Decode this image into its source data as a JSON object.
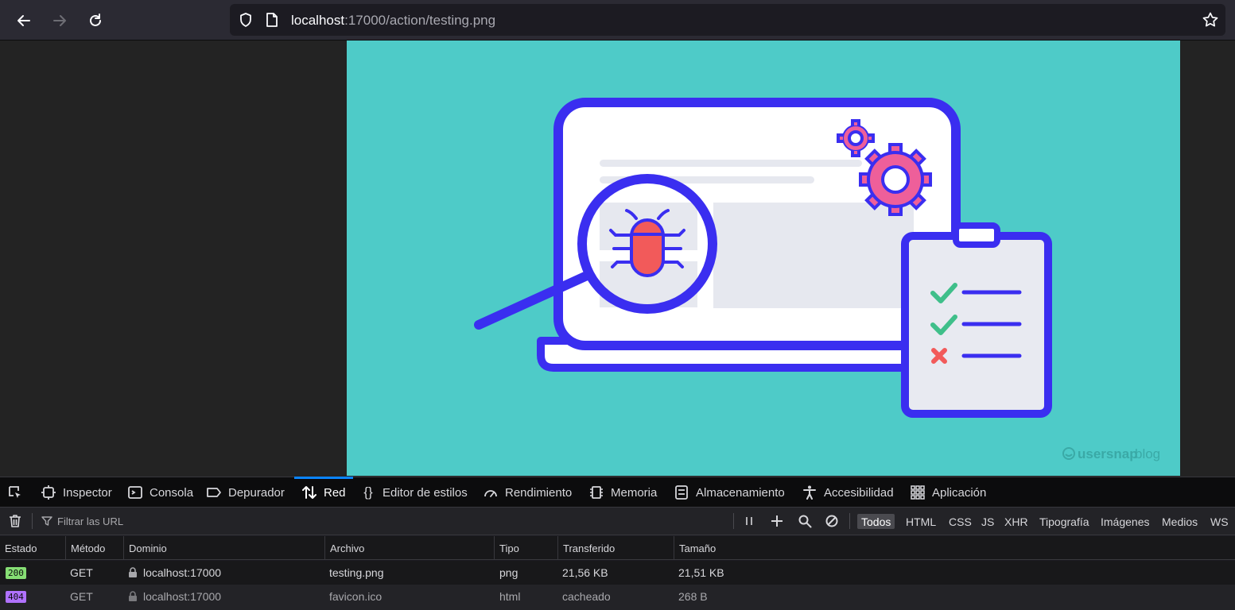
{
  "browser": {
    "url_host": "localhost",
    "url_rest": ":17000/action/testing.png"
  },
  "image": {
    "watermark_brand": "usersnap",
    "watermark_suffix": "blog",
    "colors": {
      "background": "#4ecbc8",
      "outline": "#3a2ef0",
      "bug": "#f25a5a",
      "gear": "#ee5f9a",
      "check": "#3fbf8a"
    }
  },
  "devtools": {
    "tabs": [
      {
        "label": "Inspector",
        "icon": "inspector-icon"
      },
      {
        "label": "Consola",
        "icon": "console-icon"
      },
      {
        "label": "Depurador",
        "icon": "debugger-icon"
      },
      {
        "label": "Red",
        "icon": "network-icon",
        "active": true
      },
      {
        "label": "Editor de estilos",
        "icon": "style-editor-icon"
      },
      {
        "label": "Rendimiento",
        "icon": "performance-icon"
      },
      {
        "label": "Memoria",
        "icon": "memory-icon"
      },
      {
        "label": "Almacenamiento",
        "icon": "storage-icon"
      },
      {
        "label": "Accesibilidad",
        "icon": "accessibility-icon"
      },
      {
        "label": "Aplicación",
        "icon": "application-icon"
      }
    ],
    "filter_placeholder": "Filtrar las URL",
    "type_filters": [
      "Todos",
      "HTML",
      "CSS",
      "JS",
      "XHR",
      "Tipografía",
      "Imágenes",
      "Medios",
      "WS"
    ],
    "selected_filter": "Todos",
    "columns": [
      "Estado",
      "Método",
      "Dominio",
      "Archivo",
      "Tipo",
      "Transferido",
      "Tamaño"
    ],
    "requests": [
      {
        "status": "200",
        "method": "GET",
        "domain": "localhost:17000",
        "file": "testing.png",
        "type": "png",
        "transferred": "21,56 KB",
        "size": "21,51 KB"
      },
      {
        "status": "404",
        "method": "GET",
        "domain": "localhost:17000",
        "file": "favicon.ico",
        "type": "html",
        "transferred": "cacheado",
        "size": "268 B"
      }
    ]
  }
}
